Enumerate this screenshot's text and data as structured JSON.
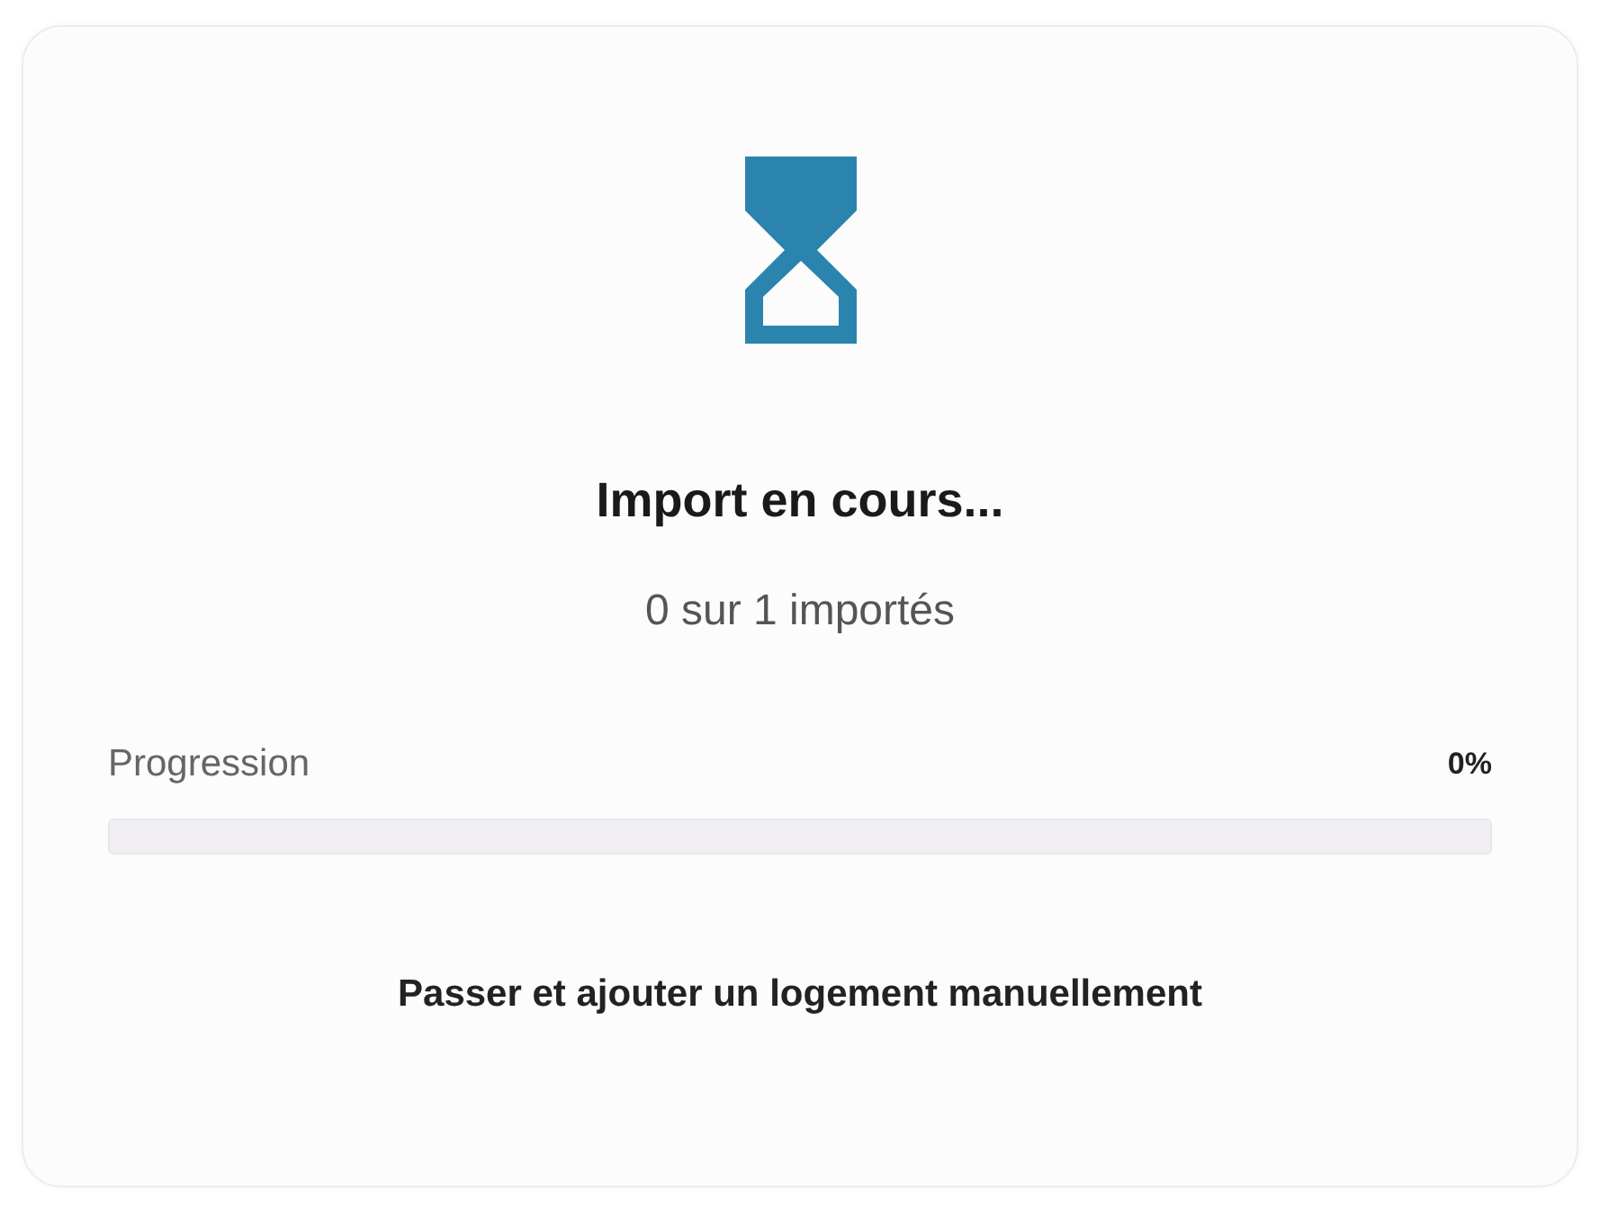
{
  "title": "Import en cours...",
  "subtitle": "0 sur 1 importés",
  "progress": {
    "label": "Progression",
    "reading": "0%",
    "level": 0
  },
  "action": {
    "label": "Passer et ajouter un logement manuellement"
  }
}
